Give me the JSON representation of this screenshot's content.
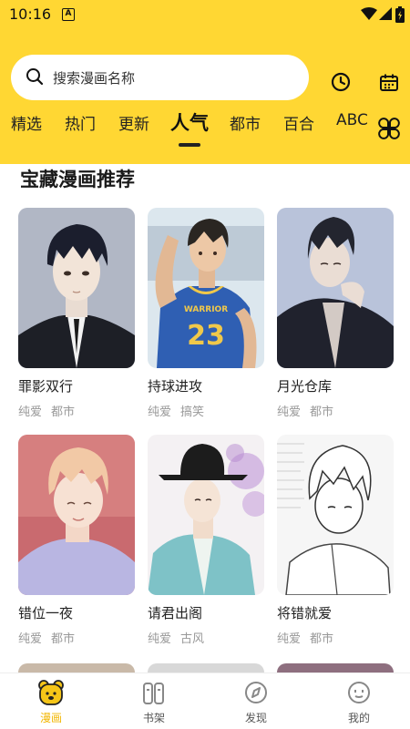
{
  "status_bar": {
    "time": "10:16",
    "notification_badge": "A"
  },
  "search": {
    "placeholder": "搜索漫画名称"
  },
  "header_icons": [
    "history-clock-icon",
    "calendar-icon"
  ],
  "tabs": [
    {
      "label": "精选",
      "active": false
    },
    {
      "label": "热门",
      "active": false
    },
    {
      "label": "更新",
      "active": false
    },
    {
      "label": "人气",
      "active": true
    },
    {
      "label": "都市",
      "active": false
    },
    {
      "label": "百合",
      "active": false
    },
    {
      "label": "ABC",
      "active": false
    }
  ],
  "section": {
    "title": "宝藏漫画推荐"
  },
  "comics": [
    {
      "title": "罪影双行",
      "tags": [
        "纯爱",
        "都市"
      ]
    },
    {
      "title": "持球进攻",
      "tags": [
        "纯爱",
        "搞笑"
      ],
      "jersey_number": "23",
      "jersey_text": "WARRIOR"
    },
    {
      "title": "月光仓库",
      "tags": [
        "纯爱",
        "都市"
      ]
    },
    {
      "title": "错位一夜",
      "tags": [
        "纯爱",
        "都市"
      ]
    },
    {
      "title": "请君出阁",
      "tags": [
        "纯爱",
        "古风"
      ]
    },
    {
      "title": "将错就爱",
      "tags": [
        "纯爱",
        "都市"
      ]
    }
  ],
  "bottom_nav": [
    {
      "label": "漫画",
      "icon": "bear-comic-icon",
      "active": true
    },
    {
      "label": "书架",
      "icon": "bookshelf-icon",
      "active": false
    },
    {
      "label": "发现",
      "icon": "compass-icon",
      "active": false
    },
    {
      "label": "我的",
      "icon": "smiley-profile-icon",
      "active": false
    }
  ],
  "colors": {
    "brand_yellow": "#FFD733",
    "active_nav": "#F2B705",
    "tag_gray": "#999999"
  }
}
